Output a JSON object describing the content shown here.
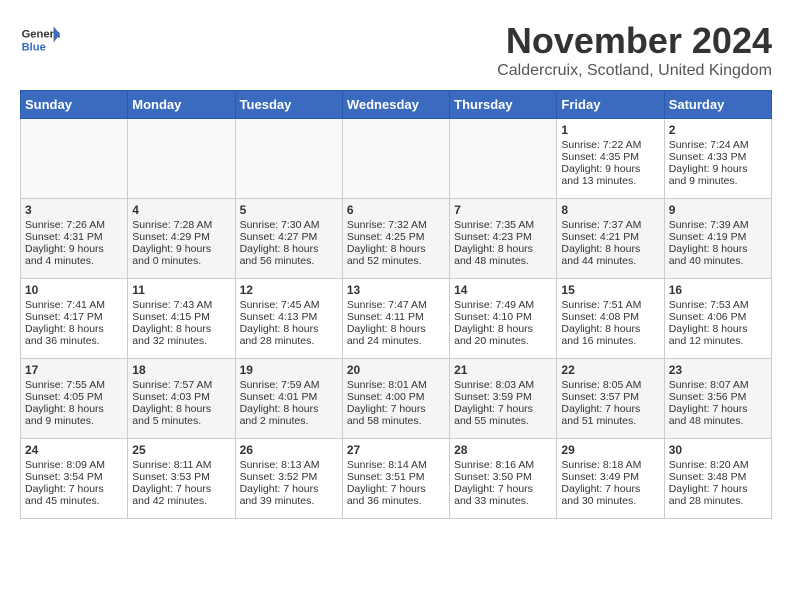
{
  "header": {
    "logo_line1": "General",
    "logo_line2": "Blue",
    "month": "November 2024",
    "location": "Caldercruix, Scotland, United Kingdom"
  },
  "days_of_week": [
    "Sunday",
    "Monday",
    "Tuesday",
    "Wednesday",
    "Thursday",
    "Friday",
    "Saturday"
  ],
  "weeks": [
    {
      "days": [
        {
          "date": "",
          "content": ""
        },
        {
          "date": "",
          "content": ""
        },
        {
          "date": "",
          "content": ""
        },
        {
          "date": "",
          "content": ""
        },
        {
          "date": "",
          "content": ""
        },
        {
          "date": "1",
          "content": "Sunrise: 7:22 AM\nSunset: 4:35 PM\nDaylight: 9 hours and 13 minutes."
        },
        {
          "date": "2",
          "content": "Sunrise: 7:24 AM\nSunset: 4:33 PM\nDaylight: 9 hours and 9 minutes."
        }
      ]
    },
    {
      "days": [
        {
          "date": "3",
          "content": "Sunrise: 7:26 AM\nSunset: 4:31 PM\nDaylight: 9 hours and 4 minutes."
        },
        {
          "date": "4",
          "content": "Sunrise: 7:28 AM\nSunset: 4:29 PM\nDaylight: 9 hours and 0 minutes."
        },
        {
          "date": "5",
          "content": "Sunrise: 7:30 AM\nSunset: 4:27 PM\nDaylight: 8 hours and 56 minutes."
        },
        {
          "date": "6",
          "content": "Sunrise: 7:32 AM\nSunset: 4:25 PM\nDaylight: 8 hours and 52 minutes."
        },
        {
          "date": "7",
          "content": "Sunrise: 7:35 AM\nSunset: 4:23 PM\nDaylight: 8 hours and 48 minutes."
        },
        {
          "date": "8",
          "content": "Sunrise: 7:37 AM\nSunset: 4:21 PM\nDaylight: 8 hours and 44 minutes."
        },
        {
          "date": "9",
          "content": "Sunrise: 7:39 AM\nSunset: 4:19 PM\nDaylight: 8 hours and 40 minutes."
        }
      ]
    },
    {
      "days": [
        {
          "date": "10",
          "content": "Sunrise: 7:41 AM\nSunset: 4:17 PM\nDaylight: 8 hours and 36 minutes."
        },
        {
          "date": "11",
          "content": "Sunrise: 7:43 AM\nSunset: 4:15 PM\nDaylight: 8 hours and 32 minutes."
        },
        {
          "date": "12",
          "content": "Sunrise: 7:45 AM\nSunset: 4:13 PM\nDaylight: 8 hours and 28 minutes."
        },
        {
          "date": "13",
          "content": "Sunrise: 7:47 AM\nSunset: 4:11 PM\nDaylight: 8 hours and 24 minutes."
        },
        {
          "date": "14",
          "content": "Sunrise: 7:49 AM\nSunset: 4:10 PM\nDaylight: 8 hours and 20 minutes."
        },
        {
          "date": "15",
          "content": "Sunrise: 7:51 AM\nSunset: 4:08 PM\nDaylight: 8 hours and 16 minutes."
        },
        {
          "date": "16",
          "content": "Sunrise: 7:53 AM\nSunset: 4:06 PM\nDaylight: 8 hours and 12 minutes."
        }
      ]
    },
    {
      "days": [
        {
          "date": "17",
          "content": "Sunrise: 7:55 AM\nSunset: 4:05 PM\nDaylight: 8 hours and 9 minutes."
        },
        {
          "date": "18",
          "content": "Sunrise: 7:57 AM\nSunset: 4:03 PM\nDaylight: 8 hours and 5 minutes."
        },
        {
          "date": "19",
          "content": "Sunrise: 7:59 AM\nSunset: 4:01 PM\nDaylight: 8 hours and 2 minutes."
        },
        {
          "date": "20",
          "content": "Sunrise: 8:01 AM\nSunset: 4:00 PM\nDaylight: 7 hours and 58 minutes."
        },
        {
          "date": "21",
          "content": "Sunrise: 8:03 AM\nSunset: 3:59 PM\nDaylight: 7 hours and 55 minutes."
        },
        {
          "date": "22",
          "content": "Sunrise: 8:05 AM\nSunset: 3:57 PM\nDaylight: 7 hours and 51 minutes."
        },
        {
          "date": "23",
          "content": "Sunrise: 8:07 AM\nSunset: 3:56 PM\nDaylight: 7 hours and 48 minutes."
        }
      ]
    },
    {
      "days": [
        {
          "date": "24",
          "content": "Sunrise: 8:09 AM\nSunset: 3:54 PM\nDaylight: 7 hours and 45 minutes."
        },
        {
          "date": "25",
          "content": "Sunrise: 8:11 AM\nSunset: 3:53 PM\nDaylight: 7 hours and 42 minutes."
        },
        {
          "date": "26",
          "content": "Sunrise: 8:13 AM\nSunset: 3:52 PM\nDaylight: 7 hours and 39 minutes."
        },
        {
          "date": "27",
          "content": "Sunrise: 8:14 AM\nSunset: 3:51 PM\nDaylight: 7 hours and 36 minutes."
        },
        {
          "date": "28",
          "content": "Sunrise: 8:16 AM\nSunset: 3:50 PM\nDaylight: 7 hours and 33 minutes."
        },
        {
          "date": "29",
          "content": "Sunrise: 8:18 AM\nSunset: 3:49 PM\nDaylight: 7 hours and 30 minutes."
        },
        {
          "date": "30",
          "content": "Sunrise: 8:20 AM\nSunset: 3:48 PM\nDaylight: 7 hours and 28 minutes."
        }
      ]
    }
  ]
}
